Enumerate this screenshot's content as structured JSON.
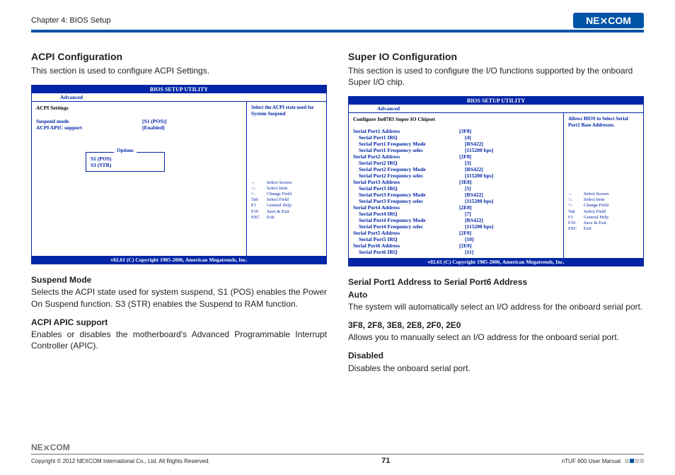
{
  "header": {
    "chapter": "Chapter 4: BIOS Setup",
    "brand": "NEXCOM"
  },
  "left": {
    "title": "ACPI Configuration",
    "intro": "This section is used to configure ACPI Settings.",
    "bios": {
      "title": "BIOS SETUP UTILITY",
      "tab": "Advanced",
      "header_line": "ACPI Settings",
      "rows": [
        {
          "label": "Suspend mode",
          "value": "[S1 (POS)]"
        },
        {
          "label": "ACPI APIC support",
          "value": "[Enabled]"
        }
      ],
      "popup": {
        "title": "Options",
        "opt1": "S1 (POS)",
        "opt2": "S3 (STR)"
      },
      "side_hint": "Select the ACPI state used for System Suspend",
      "help": [
        {
          "k": "←",
          "v": "Select Screen"
        },
        {
          "k": "↑↓",
          "v": "Select Item"
        },
        {
          "k": "+-",
          "v": "Change Field"
        },
        {
          "k": "Tab",
          "v": "Select Field"
        },
        {
          "k": "F1",
          "v": "General Help"
        },
        {
          "k": "F10",
          "v": "Save & Exit"
        },
        {
          "k": "ESC",
          "v": "Exit"
        }
      ],
      "foot": "v02.61 (C) Copyright 1985-2006, American Megatrends, Inc."
    },
    "desc_h1": "Suspend Mode",
    "desc_p1": "Selects the ACPI state used for system suspend, S1 (POS) enables the Power On Suspend function. S3 (STR) enables the Suspend to RAM function.",
    "desc_h2": "ACPI APIC support",
    "desc_p2": "Enables or disables the motherboard's Advanced Programmable Interrupt Controller (APIC)."
  },
  "right": {
    "title": "Super IO Configuration",
    "intro": "This section is used to configure the I/O functions supported by the onboard Super I/O chip.",
    "bios": {
      "title": "BIOS SETUP UTILITY",
      "tab": "Advanced",
      "header_line": "Configure Ite8783 Super IO Chipset",
      "rows": [
        {
          "label": "Serial Port1 Address",
          "value": "[3F8]",
          "indent": false
        },
        {
          "label": "Serial Port1 IRQ",
          "value": "[4]",
          "indent": true
        },
        {
          "label": "Serial Port1 Frequency Mode",
          "value": "[RS422]",
          "indent": true
        },
        {
          "label": "Serial Port1 Frequency selec",
          "value": "[115200 bps]",
          "indent": true
        },
        {
          "label": "Serial Port2 Address",
          "value": "[2F8]",
          "indent": false
        },
        {
          "label": "Serial Port2 IRQ",
          "value": "[3]",
          "indent": true
        },
        {
          "label": "Serial Port2 Frequency Mode",
          "value": "[RS422]",
          "indent": true
        },
        {
          "label": "Serial Port2 Frequency selec",
          "value": "[115200 bps]",
          "indent": true
        },
        {
          "label": "Serial Port3 Address",
          "value": "[3E8]",
          "indent": false
        },
        {
          "label": "Serial Port3 IRQ",
          "value": "[5]",
          "indent": true
        },
        {
          "label": "Serial Port3 Frequency Mode",
          "value": "[RS422]",
          "indent": true
        },
        {
          "label": "Serial Port3 Frequency selec",
          "value": "[115200 bps]",
          "indent": true
        },
        {
          "label": "Serial Port4 Address",
          "value": "[2E8]",
          "indent": false
        },
        {
          "label": "Serial Port4 IRQ",
          "value": "[7]",
          "indent": true
        },
        {
          "label": "Serial Port4 Frequency Mode",
          "value": "[RS422]",
          "indent": true
        },
        {
          "label": "Serial Port4 Frequency selec",
          "value": "[115200 bps]",
          "indent": true
        },
        {
          "label": "Serial Port5 Address",
          "value": "[2F0]",
          "indent": false
        },
        {
          "label": "Serial Port5 IRQ",
          "value": "[10]",
          "indent": true
        },
        {
          "label": "Serial Port6 Address",
          "value": "[2E0]",
          "indent": false
        },
        {
          "label": "Serial Port6 IRQ",
          "value": "[11]",
          "indent": true
        }
      ],
      "side_hint": "Allows BIOS to Select Serial Port1 Base Addresses.",
      "help": [
        {
          "k": "←",
          "v": "Select Screen"
        },
        {
          "k": "↑↓",
          "v": "Select Item"
        },
        {
          "k": "+-",
          "v": "Change Field"
        },
        {
          "k": "Tab",
          "v": "Select Field"
        },
        {
          "k": "F1",
          "v": "General Help"
        },
        {
          "k": "F10",
          "v": "Save & Exit"
        },
        {
          "k": "ESC",
          "v": "Exit"
        }
      ],
      "foot": "v02.61 (C) Copyright 1985-2006, American Megatrends, Inc."
    },
    "desc_h1": "Serial Port1 Address to Serial Port6 Address",
    "desc_h1b": "Auto",
    "desc_p1": "The system will automatically select an I/O address for the onboard serial port.",
    "desc_h2": "3F8, 2F8, 3E8, 2E8, 2F0, 2E0",
    "desc_p2": "Allows you to manually select an I/O address for the onboard serial port.",
    "desc_h3": "Disabled",
    "desc_p3": "Disables the onboard serial port."
  },
  "footer": {
    "copyright": "Copyright © 2012 NEXCOM International Co., Ltd. All Rights Reserved.",
    "page": "71",
    "manual": "nTUF 600 User Manual",
    "brand": "NEXCOM"
  }
}
